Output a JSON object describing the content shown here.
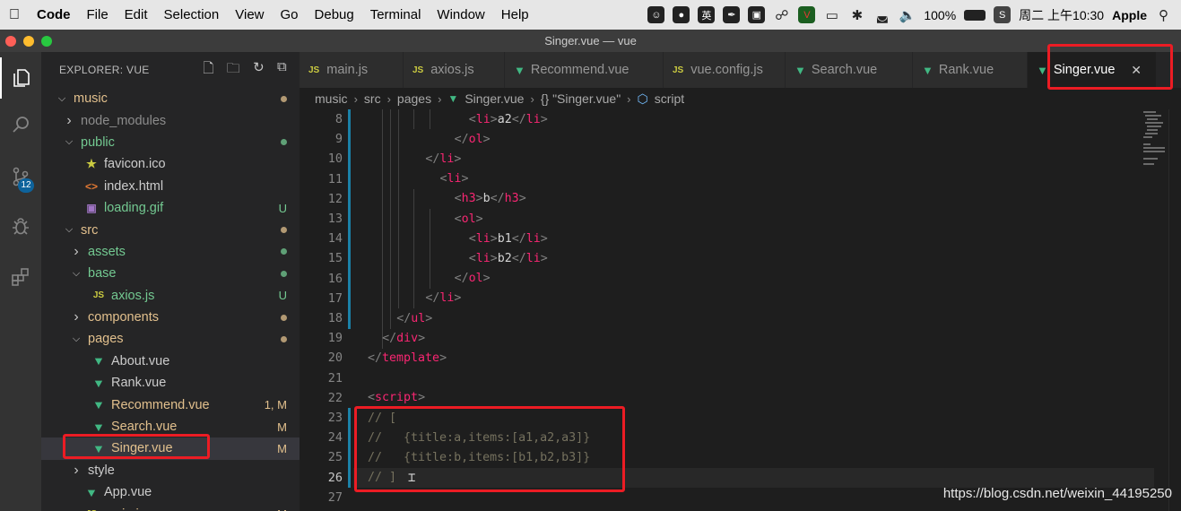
{
  "menubar": {
    "app_name": "Code",
    "items": [
      "File",
      "Edit",
      "Selection",
      "View",
      "Go",
      "Debug",
      "Terminal",
      "Window",
      "Help"
    ],
    "status_icons": [
      "smiley-icon",
      "microphone-icon",
      "input-method-icon",
      "feather-icon",
      "screen-icon",
      "wechat-icon",
      "vscode-icon",
      "airplay-icon",
      "bluetooth-icon",
      "wifi-icon",
      "volume-icon"
    ],
    "input_method": "英",
    "battery": "100%",
    "clock": "周二 上午10:30",
    "user": "Apple"
  },
  "window": {
    "title": "Singer.vue — vue"
  },
  "activity_bar": {
    "items": [
      "files-icon",
      "search-icon",
      "source-control-icon",
      "debug-icon",
      "extensions-icon"
    ],
    "scm_badge": "12"
  },
  "explorer": {
    "header": "EXPLORER: VUE",
    "tree": [
      {
        "name": "music",
        "kind": "folder",
        "open": true,
        "depth": 0,
        "status": "dot",
        "color": "#e2c08d"
      },
      {
        "name": "node_modules",
        "kind": "folder",
        "open": false,
        "depth": 1,
        "status": "",
        "color": "#8c8c8c"
      },
      {
        "name": "public",
        "kind": "folder",
        "open": true,
        "depth": 1,
        "status": "dot",
        "color": "#73c991"
      },
      {
        "name": "favicon.ico",
        "kind": "star",
        "depth": 2,
        "status": "",
        "color": "#cccccc"
      },
      {
        "name": "index.html",
        "kind": "html",
        "depth": 2,
        "status": "",
        "color": "#cccccc"
      },
      {
        "name": "loading.gif",
        "kind": "gif",
        "depth": 2,
        "status": "U",
        "color": "#73c991"
      },
      {
        "name": "src",
        "kind": "folder",
        "open": true,
        "depth": 1,
        "status": "dot",
        "color": "#e2c08d"
      },
      {
        "name": "assets",
        "kind": "folder",
        "open": false,
        "depth": 2,
        "status": "dot",
        "color": "#73c991"
      },
      {
        "name": "base",
        "kind": "folder",
        "open": true,
        "depth": 2,
        "status": "dot",
        "color": "#73c991"
      },
      {
        "name": "axios.js",
        "kind": "js",
        "depth": 3,
        "status": "U",
        "color": "#73c991"
      },
      {
        "name": "components",
        "kind": "folder",
        "open": false,
        "depth": 2,
        "status": "dot",
        "color": "#e2c08d"
      },
      {
        "name": "pages",
        "kind": "folder",
        "open": true,
        "depth": 2,
        "status": "dot",
        "color": "#e2c08d"
      },
      {
        "name": "About.vue",
        "kind": "vue",
        "depth": 3,
        "status": "",
        "color": "#cccccc"
      },
      {
        "name": "Rank.vue",
        "kind": "vue",
        "depth": 3,
        "status": "",
        "color": "#cccccc"
      },
      {
        "name": "Recommend.vue",
        "kind": "vue",
        "depth": 3,
        "status": "1, M",
        "color": "#e2c08d"
      },
      {
        "name": "Search.vue",
        "kind": "vue",
        "depth": 3,
        "status": "M",
        "color": "#e2c08d"
      },
      {
        "name": "Singer.vue",
        "kind": "vue",
        "depth": 3,
        "status": "M",
        "color": "#e2c08d",
        "selected": true
      },
      {
        "name": "style",
        "kind": "folder",
        "open": false,
        "depth": 2,
        "status": "",
        "color": "#cccccc"
      },
      {
        "name": "App.vue",
        "kind": "vue",
        "depth": 2,
        "status": "",
        "color": "#cccccc"
      },
      {
        "name": "main.js",
        "kind": "js",
        "depth": 2,
        "status": "M",
        "color": "#e2c08d"
      }
    ]
  },
  "tabs": [
    {
      "label": "main.js",
      "icon": "js",
      "active": false
    },
    {
      "label": "axios.js",
      "icon": "js",
      "active": false
    },
    {
      "label": "Recommend.vue",
      "icon": "vue",
      "active": false
    },
    {
      "label": "vue.config.js",
      "icon": "js",
      "active": false
    },
    {
      "label": "Search.vue",
      "icon": "vue",
      "active": false
    },
    {
      "label": "Rank.vue",
      "icon": "vue",
      "active": false
    },
    {
      "label": "Singer.vue",
      "icon": "vue",
      "active": true
    }
  ],
  "breadcrumb": {
    "parts": [
      "music",
      "src",
      "pages",
      "Singer.vue",
      "{} \"Singer.vue\"",
      "script"
    ]
  },
  "editor": {
    "current_line": 26,
    "lines": [
      {
        "n": 8,
        "indent": 7,
        "tokens": [
          [
            "p",
            "<"
          ],
          [
            "tg",
            "li"
          ],
          [
            "p",
            ">"
          ],
          [
            "tx",
            "a2"
          ],
          [
            "p",
            "</"
          ],
          [
            "tg",
            "li"
          ],
          [
            "p",
            ">"
          ]
        ]
      },
      {
        "n": 9,
        "indent": 6,
        "tokens": [
          [
            "p",
            "</"
          ],
          [
            "tg",
            "ol"
          ],
          [
            "p",
            ">"
          ]
        ]
      },
      {
        "n": 10,
        "indent": 4,
        "tokens": [
          [
            "p",
            "</"
          ],
          [
            "tg",
            "li"
          ],
          [
            "p",
            ">"
          ]
        ]
      },
      {
        "n": 11,
        "indent": 5,
        "tokens": [
          [
            "p",
            "<"
          ],
          [
            "tg",
            "li"
          ],
          [
            "p",
            ">"
          ]
        ]
      },
      {
        "n": 12,
        "indent": 6,
        "tokens": [
          [
            "p",
            "<"
          ],
          [
            "tg",
            "h3"
          ],
          [
            "p",
            ">"
          ],
          [
            "tx",
            "b"
          ],
          [
            "p",
            "</"
          ],
          [
            "tg",
            "h3"
          ],
          [
            "p",
            ">"
          ]
        ]
      },
      {
        "n": 13,
        "indent": 6,
        "tokens": [
          [
            "p",
            "<"
          ],
          [
            "tg",
            "ol"
          ],
          [
            "p",
            ">"
          ]
        ]
      },
      {
        "n": 14,
        "indent": 7,
        "tokens": [
          [
            "p",
            "<"
          ],
          [
            "tg",
            "li"
          ],
          [
            "p",
            ">"
          ],
          [
            "tx",
            "b1"
          ],
          [
            "p",
            "</"
          ],
          [
            "tg",
            "li"
          ],
          [
            "p",
            ">"
          ]
        ]
      },
      {
        "n": 15,
        "indent": 7,
        "tokens": [
          [
            "p",
            "<"
          ],
          [
            "tg",
            "li"
          ],
          [
            "p",
            ">"
          ],
          [
            "tx",
            "b2"
          ],
          [
            "p",
            "</"
          ],
          [
            "tg",
            "li"
          ],
          [
            "p",
            ">"
          ]
        ]
      },
      {
        "n": 16,
        "indent": 6,
        "tokens": [
          [
            "p",
            "</"
          ],
          [
            "tg",
            "ol"
          ],
          [
            "p",
            ">"
          ]
        ]
      },
      {
        "n": 17,
        "indent": 4,
        "tokens": [
          [
            "p",
            "</"
          ],
          [
            "tg",
            "li"
          ],
          [
            "p",
            ">"
          ]
        ]
      },
      {
        "n": 18,
        "indent": 2,
        "tokens": [
          [
            "p",
            "</"
          ],
          [
            "tg",
            "ul"
          ],
          [
            "p",
            ">"
          ]
        ]
      },
      {
        "n": 19,
        "indent": 1,
        "tokens": [
          [
            "p",
            "</"
          ],
          [
            "tg",
            "div"
          ],
          [
            "p",
            ">"
          ]
        ]
      },
      {
        "n": 20,
        "indent": 0,
        "tokens": [
          [
            "p",
            "</"
          ],
          [
            "tg",
            "template"
          ],
          [
            "p",
            ">"
          ]
        ]
      },
      {
        "n": 21,
        "indent": 0,
        "tokens": []
      },
      {
        "n": 22,
        "indent": 0,
        "tokens": [
          [
            "p",
            "<"
          ],
          [
            "tg",
            "script"
          ],
          [
            "p",
            ">"
          ]
        ]
      },
      {
        "n": 23,
        "indent": 0,
        "tokens": [
          [
            "cm",
            "// ["
          ]
        ]
      },
      {
        "n": 24,
        "indent": 0,
        "tokens": [
          [
            "cm",
            "//   {title:a,items:[a1,a2,a3]}"
          ]
        ]
      },
      {
        "n": 25,
        "indent": 0,
        "tokens": [
          [
            "cm",
            "//   {title:b,items:[b1,b2,b3]}"
          ]
        ]
      },
      {
        "n": 26,
        "indent": 0,
        "tokens": [
          [
            "cm",
            "// ]"
          ]
        ]
      },
      {
        "n": 27,
        "indent": 0,
        "tokens": []
      }
    ]
  },
  "watermark": "https://blog.csdn.net/weixin_44195250",
  "colors": {
    "annotation": "#ec1c24",
    "vue": "#41b883",
    "js": "#cbcb41",
    "tag": "#f92672",
    "comment": "#75715e"
  }
}
